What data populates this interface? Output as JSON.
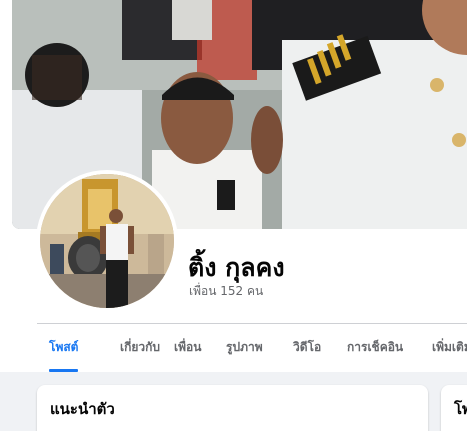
{
  "profile": {
    "name": "ติ้ง กุลคง",
    "friends": "เพื่อน 152 คน"
  },
  "tabs": [
    {
      "label": "โพสต์",
      "active": true
    },
    {
      "label": "เกี่ยวกับ",
      "active": false
    },
    {
      "label": "เพื่อน",
      "active": false
    },
    {
      "label": "รูปภาพ",
      "active": false
    },
    {
      "label": "วิดีโอ",
      "active": false
    },
    {
      "label": "การเช็คอิน",
      "active": false
    },
    {
      "label": "เพิ่มเติม",
      "active": false
    }
  ],
  "cards": {
    "intro_title": "แนะนำตัว",
    "right_title": "โพ"
  },
  "colors": {
    "accent": "#1877f2",
    "text_secondary": "#65676b",
    "page_background": "#f0f2f5"
  }
}
